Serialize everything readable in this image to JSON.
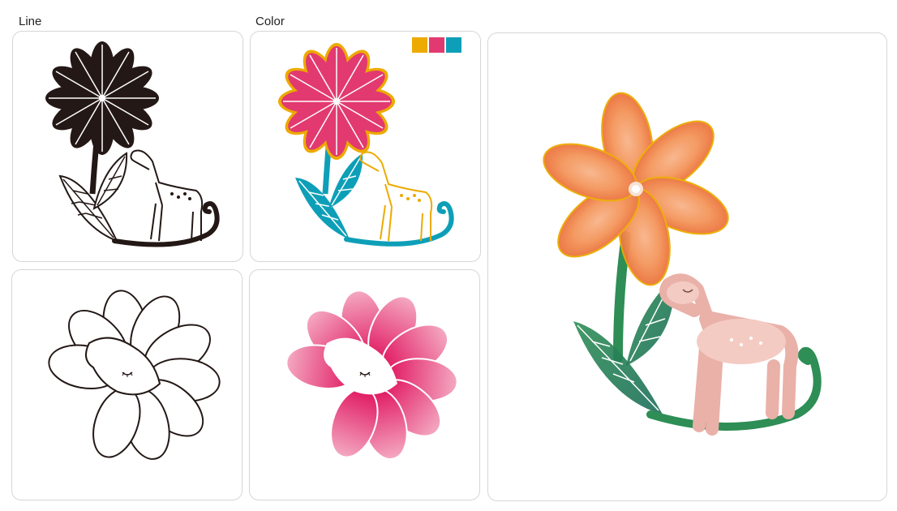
{
  "labels": {
    "line": "Line",
    "color": "Color"
  },
  "palette": [
    {
      "name": "mustard",
      "hex": "#EDAA00"
    },
    {
      "name": "magenta",
      "hex": "#E23A70"
    },
    {
      "name": "teal",
      "hex": "#0E9FB8"
    }
  ],
  "illustration_colors": {
    "black_line": "#231815",
    "pink": "#E0155E",
    "pink_light": "#F4A9C2",
    "orange": "#E8622E",
    "orange_light": "#F4955A",
    "green": "#2E8E55",
    "green_dark": "#1C6E5A",
    "deer_pink": "#F4CBC3"
  }
}
